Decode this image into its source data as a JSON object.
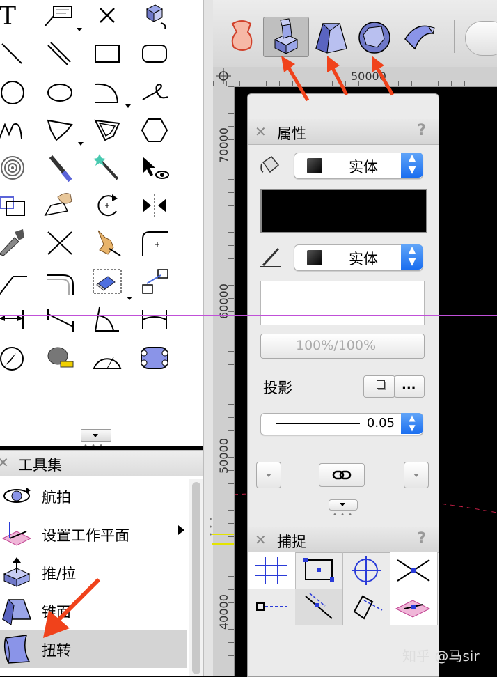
{
  "top_toolbar": {
    "icons": [
      "extrude-icon",
      "push-pull-icon",
      "taper-icon",
      "shell-icon",
      "sweep-icon"
    ]
  },
  "rulers": {
    "horizontal_label": "50000",
    "vertical_labels": [
      "70000",
      "60000",
      "50000",
      "40000"
    ]
  },
  "attributes_palette": {
    "title": "属性",
    "help": "?",
    "fill_style": "实体",
    "line_style": "实体",
    "opacity": "100%/100%",
    "shadow_label": "投影",
    "shadow_more": "...",
    "line_weight": "0.05"
  },
  "snapping_palette": {
    "title": "捕捉",
    "help": "?"
  },
  "toolsets": {
    "title": "工具集",
    "items": [
      {
        "label": "航拍"
      },
      {
        "label": "设置工作平面"
      },
      {
        "label": "推/拉"
      },
      {
        "label": "锥面"
      },
      {
        "label": "扭转"
      }
    ]
  },
  "watermark": "知乎 @马sir",
  "colors": {
    "accent_arrow": "#f0421b",
    "selected_row": "#d4d4d4",
    "stepper_blue": "#2f7ef3"
  }
}
